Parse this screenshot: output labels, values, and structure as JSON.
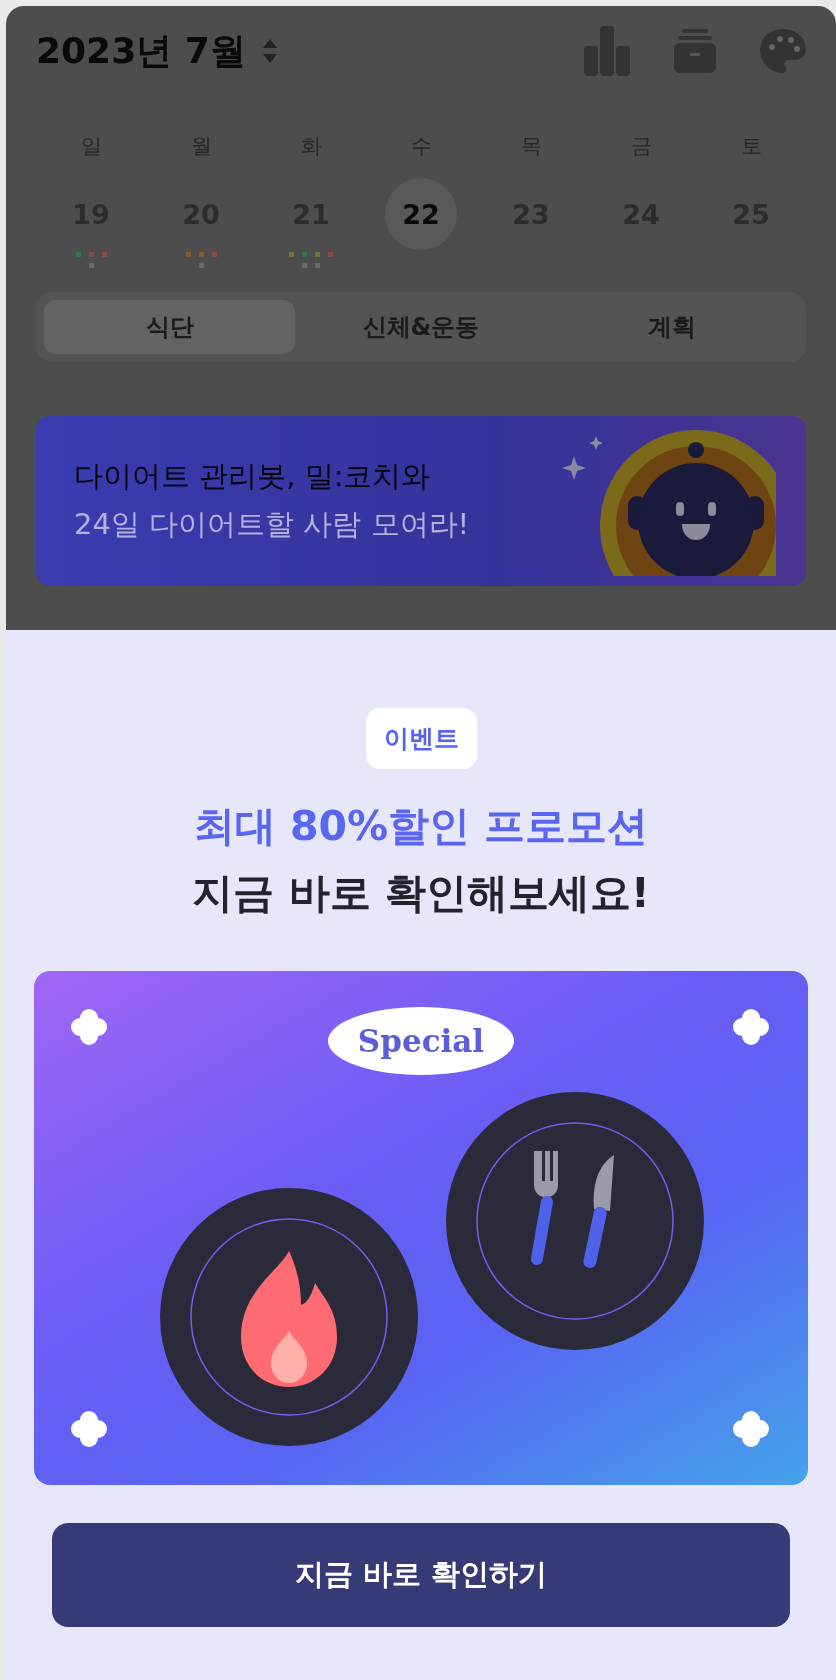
{
  "header": {
    "title": "2023년 7월"
  },
  "week": [
    {
      "weekday": "일",
      "date": "19",
      "selected": false,
      "dots_top": [
        {
          "color": "#2f7a4c"
        },
        {
          "color": "#8c4b4b"
        },
        {
          "color": "#8c4b4b"
        }
      ],
      "dots_bottom": [
        {
          "color": "#6a6a6a"
        }
      ]
    },
    {
      "weekday": "월",
      "date": "20",
      "selected": false,
      "dots_top": [
        {
          "color": "#8a5a2c"
        },
        {
          "color": "#8a5a2c"
        },
        {
          "color": "#8c4b4b"
        }
      ],
      "dots_bottom": [
        {
          "color": "#6a6a6a"
        }
      ]
    },
    {
      "weekday": "화",
      "date": "21",
      "selected": false,
      "dots_top": [
        {
          "color": "#6f7a2c"
        },
        {
          "color": "#2f7a4c"
        },
        {
          "color": "#6f7a2c"
        },
        {
          "color": "#8c4b4b"
        }
      ],
      "dots_bottom": [
        {
          "color": "#6a6a6a"
        },
        {
          "color": "#6a6a6a"
        }
      ]
    },
    {
      "weekday": "수",
      "date": "22",
      "selected": true
    },
    {
      "weekday": "목",
      "date": "23",
      "selected": false
    },
    {
      "weekday": "금",
      "date": "24",
      "selected": false
    },
    {
      "weekday": "토",
      "date": "25",
      "selected": false
    }
  ],
  "tabs": [
    {
      "label": "식단",
      "selected": true
    },
    {
      "label": "신체&운동",
      "selected": false
    },
    {
      "label": "계획",
      "selected": false
    }
  ],
  "banner": {
    "line_1": "다이어트 관리봇, 밀:코치와",
    "line_2": "24일 다이어트할 사람 모여라!"
  },
  "sheet": {
    "tag": "이벤트",
    "headline_1": "최대 80%할인 프로모션",
    "headline_2": "지금 바로 확인해보세요!",
    "card_label": "Special",
    "button": "지금 바로 확인하기"
  }
}
